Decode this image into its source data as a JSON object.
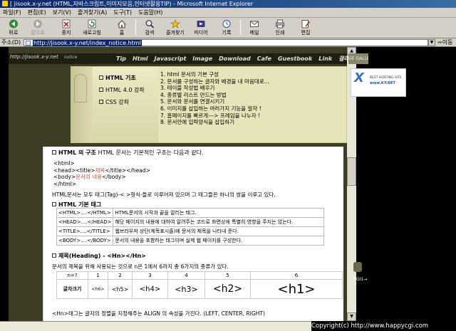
{
  "window": {
    "title": "[ jisook.x-y.net (HTML,자바스크립트,이미지모음,인터넷활용TIP) - Microsoft Internet Explorer"
  },
  "menu": [
    "파일(F)",
    "편집(E)",
    "보기(V)",
    "즐겨찾기(A)",
    "도구(T)",
    "도움말(H)"
  ],
  "toolbar": {
    "back": "뒤로",
    "forward": "앞으로",
    "stop": "중지",
    "refresh": "새로고침",
    "home": "홈",
    "search": "검색",
    "favorites": "즐겨찾기",
    "media": "미디어",
    "history": "기록",
    "mail": "메일",
    "print": "인쇄",
    "edit": "편집"
  },
  "address": {
    "label": "주소(D)",
    "url": "http://jisook.x-y.net/index_notice.html",
    "go": "이동"
  },
  "site": {
    "logo": "http://jisook.x-y.net",
    "notice": "notice",
    "nav": [
      "Tip",
      "Html",
      "Javascript",
      "Image",
      "Download",
      "Cafe",
      "Guestbook",
      "Link",
      "갤러길셔샤"
    ],
    "gallery": "GE GALLERY"
  },
  "sidelinks": [
    {
      "label": "HTML 기초"
    },
    {
      "label": "HTML 4.0 강좌"
    },
    {
      "label": "CSS 강좌"
    }
  ],
  "toc": [
    "1. html 문서의 기본 구성",
    "2. 문서를 구성하는 글자와 배경을 내 마음대로...",
    "3. 테이블 작성법 배우기",
    "4. 종류별 리스트 만드는 방법",
    "5. 문서와 문서를 연결시키기",
    "6. 이미지를 삽입하는 여러가지 기능을 알자 !",
    "7. 홈페이지를 빠르게---> 프레임을 나누자 !",
    "8. 문서안에 입력양식을 삽입하기"
  ],
  "content": {
    "section1_title": "HTML 의 구조",
    "section1_text": "HTML 문서는 기본적인 구조는 다음과 같다.",
    "code_html_open": "<html>",
    "code_head_pre": "<head><title>",
    "code_head_red": "제목",
    "code_head_post": "</title></head>",
    "code_body_pre": "<body>",
    "code_body_red": "문서의 내용",
    "code_body_post": "</body>",
    "code_html_close": "</html>",
    "tags_note": "HTML문서는 모두 태그(Tag)-< >형식-들로 이루어져 있으며 그 태그들은 하나의 쌍을 이루고 있다.",
    "section2_title": "HTML 기본 태그",
    "tags": [
      {
        "tag": "<HTML>....</HTML>",
        "desc": "HTML문서의 시작과 끝을 알리는 태그."
      },
      {
        "tag": "<HEAD>....</HEAD>",
        "desc": "해당 페이지의 내용에 대하여 알려주는 코드로 화면상에 특별히 영향을 주지는 않는다."
      },
      {
        "tag": "<TITLE>....</TITLE>",
        "desc": "웹브라우저 상단(제목표시줄)에 문서의 제목을 나타내 준다."
      },
      {
        "tag": "<BODY>....</BODY>",
        "desc": "문서의 내용을 포함하는 태그이며 실제 웹 페이지를 구성한다."
      }
    ],
    "section3_title": "제목(Heading) - <Hn></Hn>",
    "section3_text": "문서의 제목을 위해 사용되는 것으로 n은 1에서 6까지 총 6가지의 종류가 있다.",
    "heading_table": {
      "n_label": "n=?",
      "nums": [
        "1",
        "2",
        "3",
        "4",
        "5",
        "6"
      ],
      "row_label": "글자크기",
      "cells": [
        "<h6>",
        "<h5>",
        "<h4>",
        "<h3>",
        "<h2>",
        "<h1>"
      ]
    },
    "align_text": "<Hn>태그는 글자의 정렬을 지정해주는 ALIGN 의 속성을 가진다. (LEFT, CENTER, RIGHT)"
  },
  "ads": {
    "best_hosting": "BEST HOSTING SITE",
    "domain": "www.X-Y.NET",
    "badge": "BGI1→"
  },
  "footer": {
    "copyright": "Copyright(c) http://www.happycgi.com"
  }
}
